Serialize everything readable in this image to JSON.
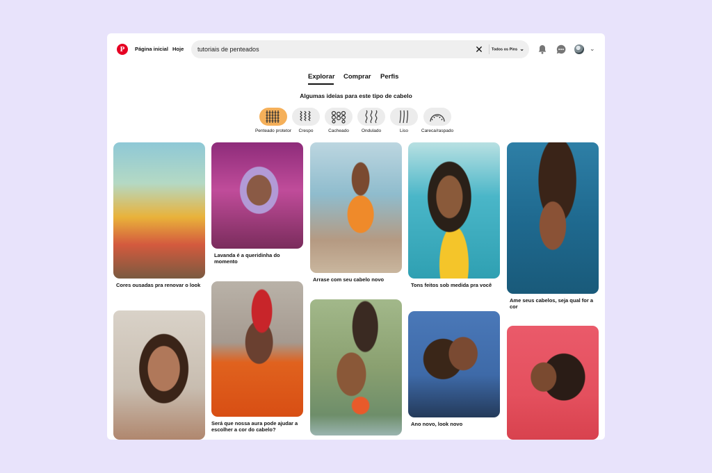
{
  "header": {
    "logo_letter": "P",
    "nav": [
      "Página inicial",
      "Hoje"
    ],
    "search": {
      "value": "tutoriais de penteados",
      "scope": "Todos os Pins"
    }
  },
  "tabs": [
    "Explorar",
    "Comprar",
    "Perfis"
  ],
  "active_tab": "Explorar",
  "section_title": "Algumas ideias para este tipo de cabelo",
  "hair_types": [
    {
      "label": "Penteado protetor",
      "icon": "braids-icon",
      "selected": true
    },
    {
      "label": "Crespo",
      "icon": "coily-icon"
    },
    {
      "label": "Cacheado",
      "icon": "curly-icon"
    },
    {
      "label": "Ondulado",
      "icon": "wavy-icon"
    },
    {
      "label": "Liso",
      "icon": "straight-icon"
    },
    {
      "label": "Careca/raspado",
      "icon": "shaved-icon"
    }
  ],
  "pins": [
    {
      "caption": "Cores ousadas pra renovar o look"
    },
    {
      "caption": "Lavanda é a queridinha do momento"
    },
    {
      "caption": "Arrase com seu cabelo novo"
    },
    {
      "caption": "Tons feitos sob medida pra você"
    },
    {
      "caption": "Ame seus cabelos, seja qual for a cor"
    },
    {
      "caption": ""
    },
    {
      "caption": "Será que nossa aura pode ajudar a escolher a cor do cabelo?"
    },
    {
      "caption": ""
    },
    {
      "caption": "Ano novo, look novo"
    },
    {
      "caption": ""
    }
  ],
  "colors": {
    "brand": "#e60023",
    "active_chip": "#f5b05a",
    "background": "#e8e3fb"
  }
}
